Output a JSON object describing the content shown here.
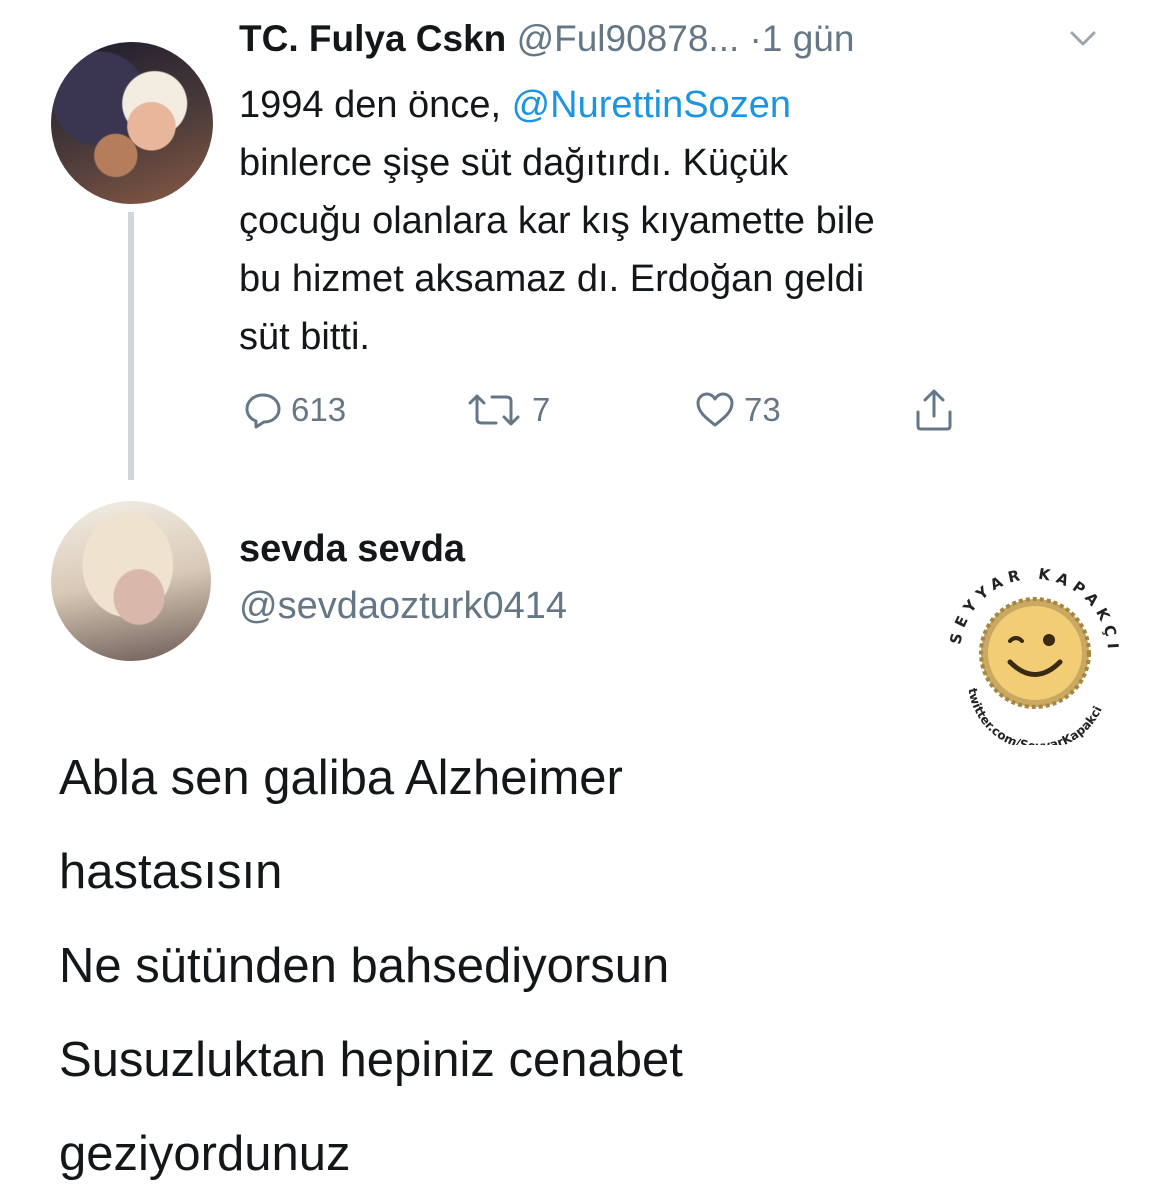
{
  "tweet": {
    "author_name": "TC. Fulya Cskn",
    "author_handle": "@Ful90878...",
    "time": "·1 gün",
    "text_lines": [
      {
        "before": "1994 den önce, ",
        "mention": "@NurettinSozen"
      },
      "binlerce şişe süt dağıtırdı. Küçük",
      "çocuğu olanlara kar kış kıyamette bile",
      "bu hizmet aksamaz dı. Erdoğan geldi",
      "süt bitti."
    ],
    "actions": {
      "replies": "613",
      "retweets": "7",
      "likes": "73"
    }
  },
  "reply": {
    "author_name": "sevda sevda",
    "author_handle": "@sevdaozturk0414",
    "text_lines": [
      "Abla sen galiba Alzheimer",
      "hastasısın",
      "Ne sütünden bahsediyorsun",
      "Susuzluktan hepiniz cenabet",
      "geziyordunuz"
    ]
  },
  "watermark": {
    "arc_text": "SEYYAR KAPAKÇI",
    "bottom_text": "twitter.com/SeyyarKapakci"
  },
  "icons": {
    "reply": "reply-icon",
    "retweet": "retweet-icon",
    "like": "heart-icon",
    "share": "share-icon",
    "menu": "chevron-down-icon"
  },
  "colors": {
    "text": "#14171a",
    "muted": "#657786",
    "mention": "#1b95e0",
    "thread_line": "#cfd6dc"
  }
}
